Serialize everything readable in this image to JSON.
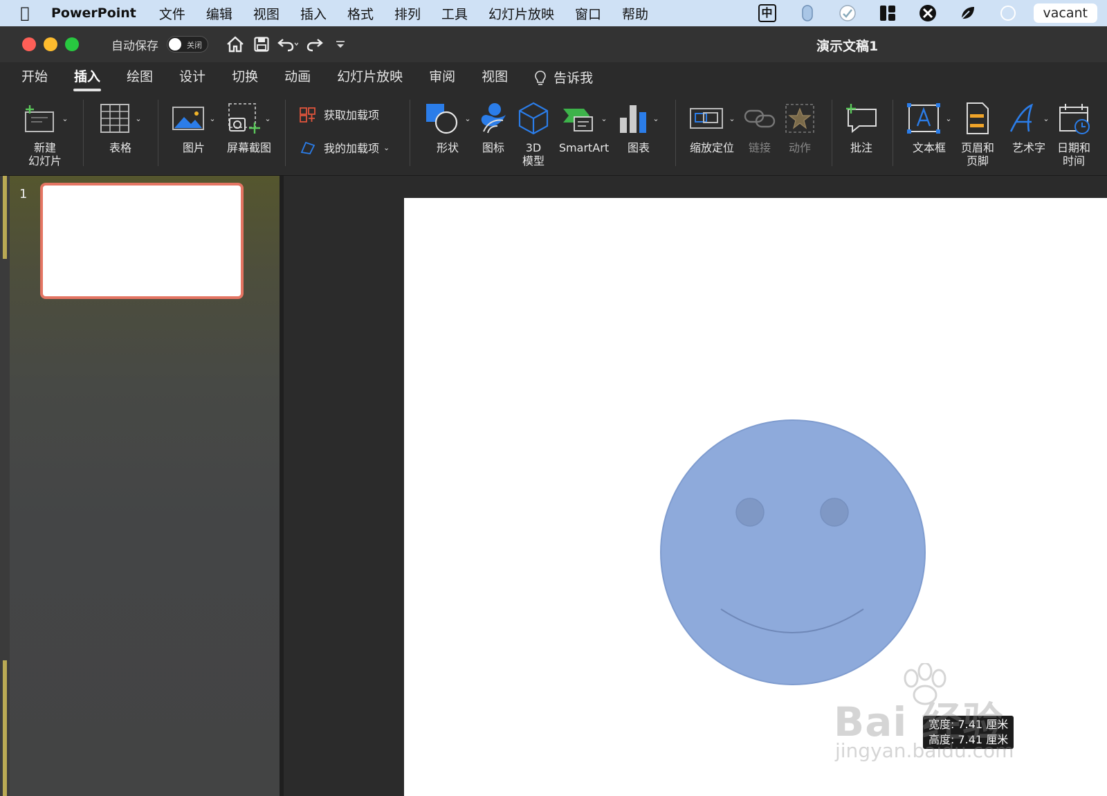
{
  "menubar": {
    "app_name": "PowerPoint",
    "items": [
      "文件",
      "编辑",
      "视图",
      "插入",
      "格式",
      "排列",
      "工具",
      "幻灯片放映",
      "窗口",
      "帮助"
    ],
    "ime": "中",
    "user": "vacant"
  },
  "titlebar": {
    "autosave_label": "自动保存",
    "autosave_state": "关闭",
    "doc_title": "演示文稿1"
  },
  "tabs": [
    "开始",
    "插入",
    "绘图",
    "设计",
    "切换",
    "动画",
    "幻灯片放映",
    "审阅",
    "视图"
  ],
  "active_tab": "插入",
  "tell_me": "告诉我",
  "ribbon": {
    "new_slide": "新建\n幻灯片",
    "table": "表格",
    "pictures": "图片",
    "screenshot": "屏幕截图",
    "get_addins": "获取加载项",
    "my_addins": "我的加载项",
    "shapes": "形状",
    "icons": "图标",
    "models_3d": "3D\n模型",
    "smartart": "SmartArt",
    "chart": "图表",
    "zoom": "缩放定位",
    "link": "链接",
    "action": "动作",
    "comment": "批注",
    "textbox": "文本框",
    "header_footer": "页眉和\n页脚",
    "wordart": "艺术字",
    "datetime": "日期和\n时间"
  },
  "slides_panel": {
    "slide_number": "1"
  },
  "size_tooltip": {
    "width": "宽度: 7.41 厘米",
    "height": "高度: 7.41 厘米"
  },
  "watermark": {
    "brand": "Bai  经验",
    "url": "jingyan.baidu.com"
  },
  "colors": {
    "shape_fill": "#8eaadb",
    "shape_stroke": "#7f9ccf",
    "thumb_border": "#e47563",
    "icon_blue": "#1f6fd8"
  }
}
